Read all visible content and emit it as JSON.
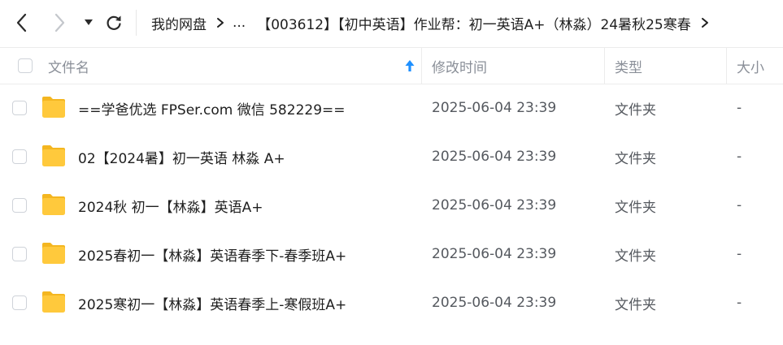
{
  "breadcrumb": {
    "root": "我的网盘",
    "ellipsis": "...",
    "current": "【003612】【初中英语】作业帮：初一英语A+（林淼）24暑秋25寒春"
  },
  "table": {
    "headers": {
      "name": "文件名",
      "modified": "修改时间",
      "type": "类型",
      "size": "大小"
    },
    "rows": [
      {
        "name": "==学爸优选 FPSer.com 微信 582229==",
        "modified": "2025-06-04 23:39",
        "type": "文件夹",
        "size": "-"
      },
      {
        "name": "02【2024暑】初一英语 林淼 A+",
        "modified": "2025-06-04 23:39",
        "type": "文件夹",
        "size": "-"
      },
      {
        "name": "2024秋 初一【林淼】英语A+",
        "modified": "2025-06-04 23:39",
        "type": "文件夹",
        "size": "-"
      },
      {
        "name": "2025春初一【林淼】英语春季下-春季班A+",
        "modified": "2025-06-04 23:39",
        "type": "文件夹",
        "size": "-"
      },
      {
        "name": "2025寒初一【林淼】英语春季上-寒假班A+",
        "modified": "2025-06-04 23:39",
        "type": "文件夹",
        "size": "-"
      }
    ]
  },
  "icons": {
    "back": "chevron-left-icon",
    "forward": "chevron-right-icon",
    "history": "caret-down-icon",
    "refresh": "refresh-icon",
    "sort": "sort-ascending-icon",
    "folder": "folder-icon"
  },
  "colors": {
    "sort_accent": "#1e90ff",
    "folder_body": "#ffc93c",
    "folder_tab": "#f4b620"
  }
}
